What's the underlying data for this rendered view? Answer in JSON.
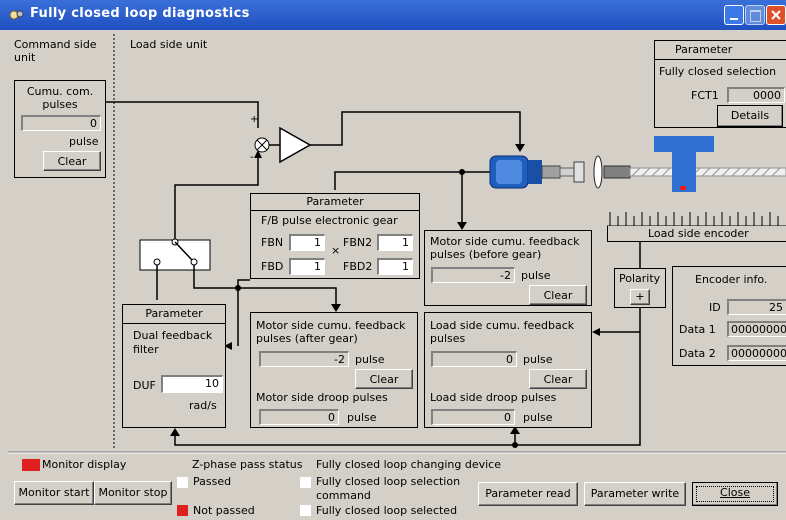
{
  "window": {
    "title": "Fully closed loop diagnostics"
  },
  "sections": {
    "command_side": "Command side unit",
    "load_side": "Load side unit"
  },
  "cumu_com": {
    "label": "Cumu. com. pulses",
    "value": "0",
    "unit": "pulse",
    "clear": "Clear"
  },
  "param_fct": {
    "header": "Parameter",
    "label": "Fully closed selection",
    "field_label": "FCT1",
    "value": "0000",
    "details": "Details"
  },
  "param_gear": {
    "header": "Parameter",
    "label": "F/B pulse electronic gear",
    "fbn_label": "FBN",
    "fbn": "1",
    "fbn2_label": "FBN2",
    "fbn2": "1",
    "fbd_label": "FBD",
    "fbd": "1",
    "fbd2_label": "FBD2",
    "fbd2": "1",
    "times": "×"
  },
  "motor_before": {
    "label": "Motor side cumu. feedback pulses (before gear)",
    "value": "-2",
    "unit": "pulse",
    "clear": "Clear"
  },
  "load_encoder": {
    "label": "Load side encoder"
  },
  "polarity": {
    "label": "Polarity",
    "value": "+"
  },
  "encoder_info": {
    "label": "Encoder info.",
    "id_label": "ID",
    "id": "25",
    "data1_label": "Data 1",
    "data1": "00000000",
    "data2_label": "Data 2",
    "data2": "00000000"
  },
  "param_dual": {
    "header": "Parameter",
    "label": "Dual feedback filter",
    "duf_label": "DUF",
    "duf": "10",
    "unit": "rad/s"
  },
  "motor_after": {
    "label": "Motor side cumu. feedback pulses (after gear)",
    "value": "-2",
    "unit": "pulse",
    "clear": "Clear",
    "droop_label": "Motor side droop pulses",
    "droop": "0",
    "droop_unit": "pulse"
  },
  "load_cumu": {
    "label": "Load side cumu. feedback pulses",
    "value": "0",
    "unit": "pulse",
    "clear": "Clear",
    "droop_label": "Load side droop pulses",
    "droop": "0",
    "droop_unit": "pulse"
  },
  "bottom": {
    "monitor_display": "Monitor display",
    "monitor_start": "Monitor start",
    "monitor_stop": "Monitor stop",
    "zphase_title": "Z-phase pass status",
    "passed": "Passed",
    "not_passed": "Not passed",
    "fc_title": "Fully closed loop changing device",
    "fc_cmd_line1": "Fully closed loop selection",
    "fc_cmd_line2": "command",
    "fc_selected": "Fully closed loop selected",
    "param_read": "Parameter read",
    "param_write": "Parameter write",
    "close": "Close"
  },
  "colors": {
    "titlebar": "#2456c8",
    "indicator_red": "#e02020",
    "indicator_white": "#ffffff",
    "motor_blue": "#1f5fc0",
    "encoder_blue": "#2f6fd0"
  }
}
